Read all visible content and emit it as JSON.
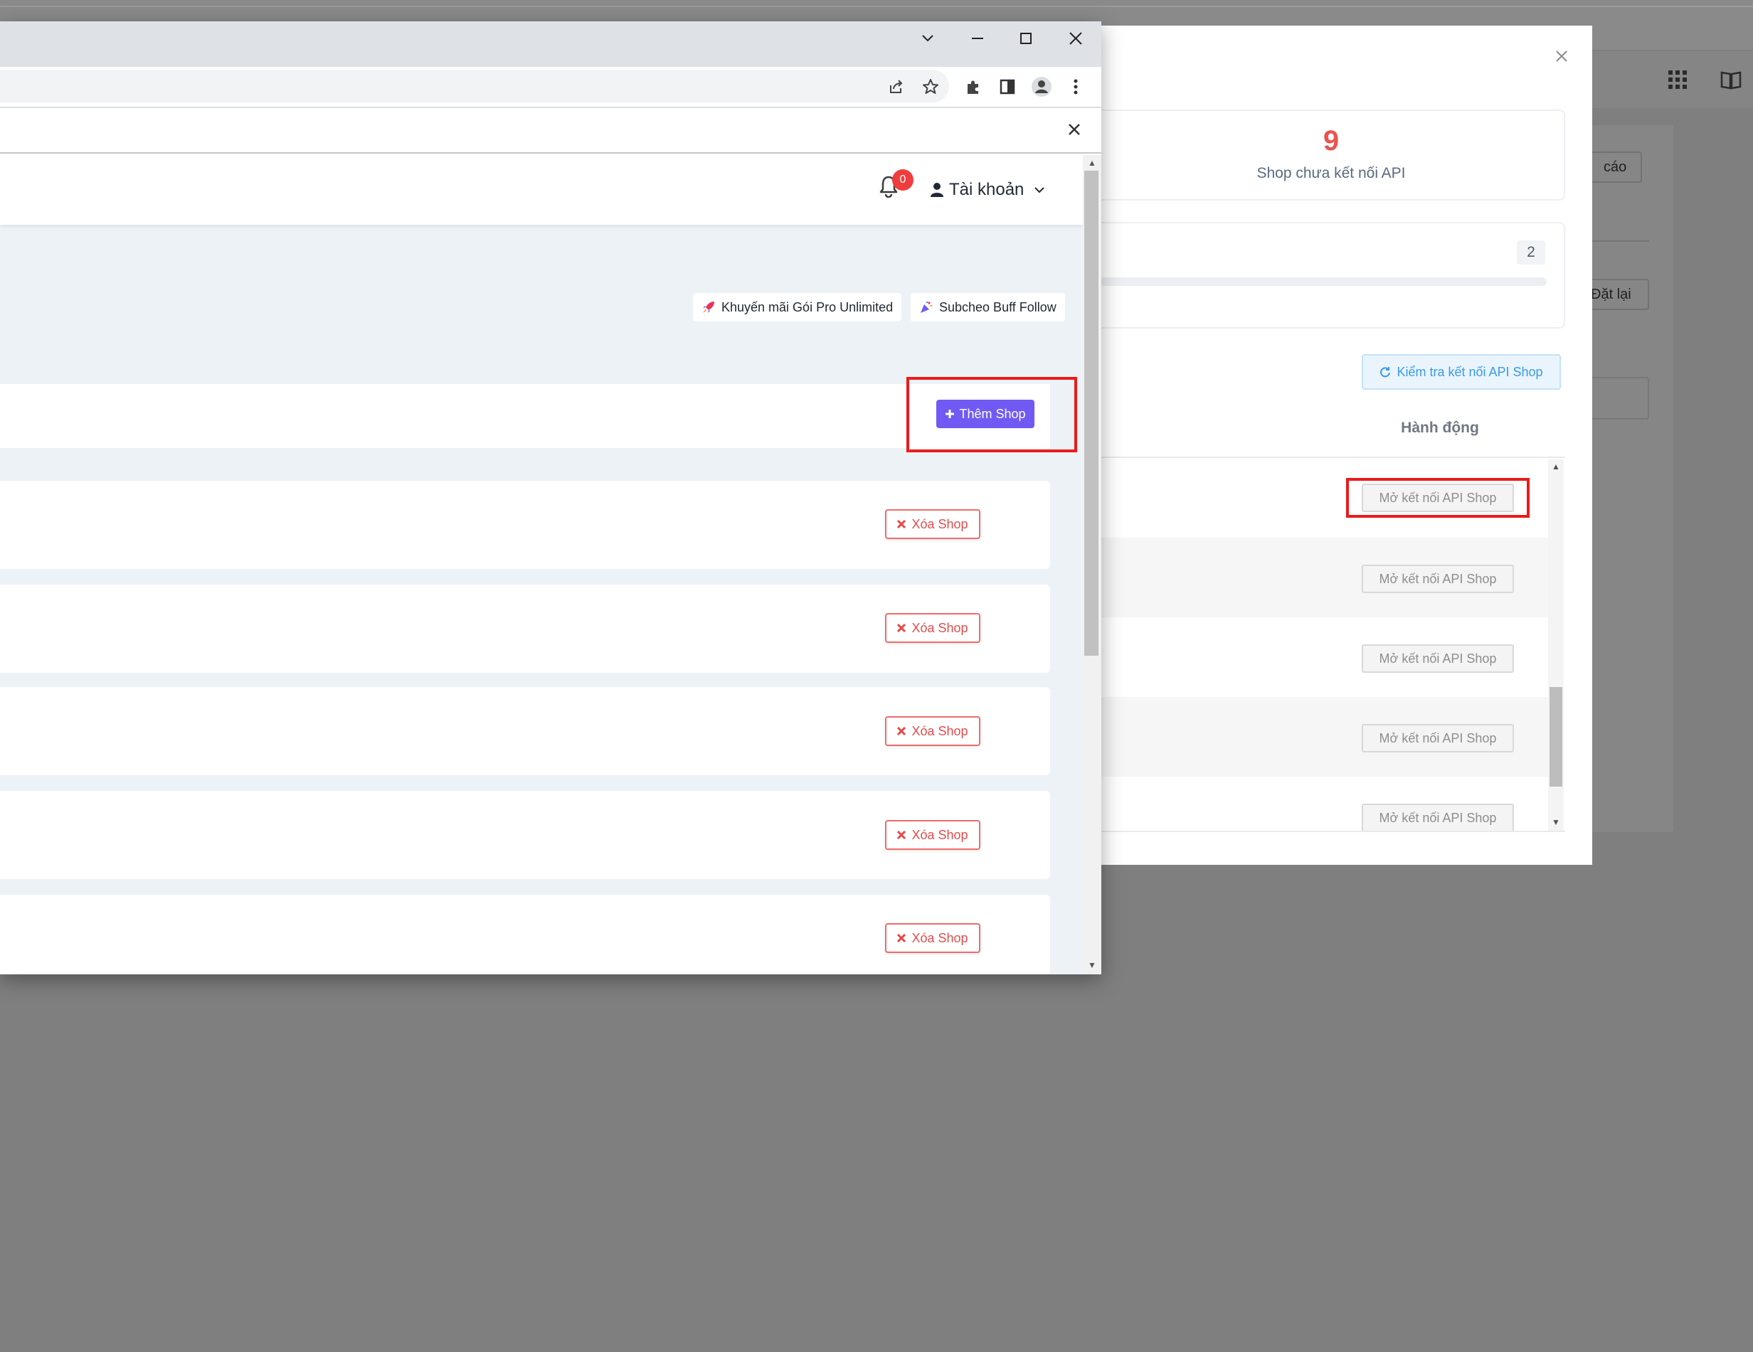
{
  "background_app": {
    "report_button_label": "cáo",
    "reset_button_label": "Đặt lại"
  },
  "api_modal": {
    "unconnected_count": "9",
    "unconnected_label": "Shop chưa kết nối API",
    "progress_count": "2",
    "check_button_label": "Kiểm tra kết nối API Shop",
    "action_column_header": "Hành động",
    "row_button_label": "Mở kết nối API Shop",
    "rows": [
      {
        "action": "Mở kết nối API Shop"
      },
      {
        "action": "Mở kết nối API Shop"
      },
      {
        "action": "Mở kết nối API Shop"
      },
      {
        "action": "Mở kết nối API Shop"
      },
      {
        "action": "Mở kết nối API Shop"
      }
    ]
  },
  "browser": {
    "window_controls": [
      "tab-search",
      "minimize",
      "maximize",
      "close"
    ],
    "toolbar_icons": [
      "share-icon",
      "bookmark-star-icon",
      "extensions-icon",
      "side-panel-icon",
      "profile-icon",
      "menu-icon"
    ]
  },
  "page": {
    "notification_count": "0",
    "account_label": "Tài khoản",
    "promos": [
      {
        "label": "Khuyến mãi Gói Pro Unlimited",
        "icon": "rocket-icon"
      },
      {
        "label": "Subcheo Buff Follow",
        "icon": "party-popper-icon"
      }
    ],
    "add_shop_label": "Thêm Shop",
    "delete_shop_label": "Xóa Shop",
    "shops": [
      {
        "delete_label": "Xóa Shop"
      },
      {
        "delete_label": "Xóa Shop"
      },
      {
        "delete_label": "Xóa Shop"
      },
      {
        "delete_label": "Xóa Shop"
      },
      {
        "delete_label": "Xóa Shop"
      }
    ]
  },
  "colors": {
    "overlay": "#7f7f7f",
    "accent_purple": "#7159f3",
    "danger_red": "#e34c4c",
    "highlight_red": "#ea1b1b",
    "info_blue": "#3d99e6",
    "stat_red": "#e8544f"
  }
}
